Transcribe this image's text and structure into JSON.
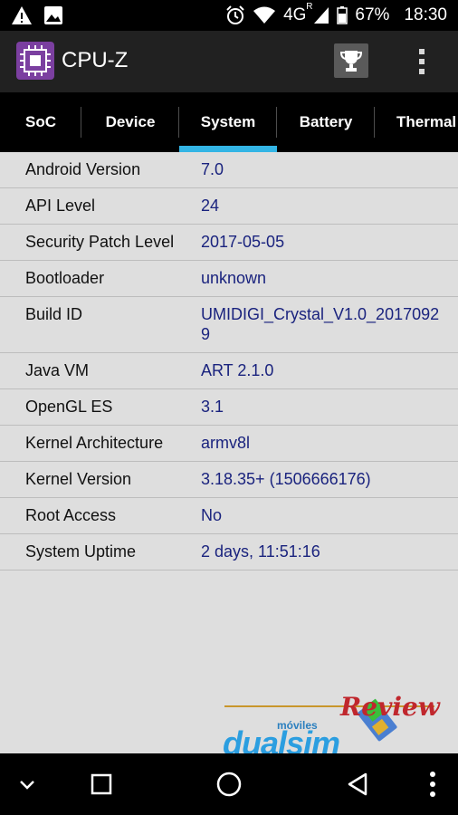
{
  "status_bar": {
    "left_icons": [
      "warning-icon",
      "image-icon"
    ],
    "right_icons": [
      "alarm-icon",
      "wifi-icon",
      "signal-icon"
    ],
    "network": "4G",
    "roaming": "R",
    "battery": "67%",
    "time": "18:30"
  },
  "app_bar": {
    "title": "CPU-Z",
    "logo_icon": "cpu-chip-icon",
    "trophy_icon": "trophy-icon",
    "menu_icon": "overflow-menu-icon"
  },
  "tabs": [
    {
      "label": "SoC",
      "active": false
    },
    {
      "label": "Device",
      "active": false
    },
    {
      "label": "System",
      "active": true
    },
    {
      "label": "Battery",
      "active": false
    },
    {
      "label": "Thermal",
      "active": false
    }
  ],
  "system_info": [
    {
      "key": "Android Version",
      "value": "7.0"
    },
    {
      "key": "API Level",
      "value": "24"
    },
    {
      "key": "Security Patch Level",
      "value": "2017-05-05"
    },
    {
      "key": "Bootloader",
      "value": "unknown"
    },
    {
      "key": "Build ID",
      "value": "UMIDIGI_Crystal_V1.0_2017092\n9"
    },
    {
      "key": "Java VM",
      "value": "ART 2.1.0"
    },
    {
      "key": "OpenGL ES",
      "value": "3.1"
    },
    {
      "key": "Kernel Architecture",
      "value": "armv8l"
    },
    {
      "key": "Kernel Version",
      "value": "3.18.35+ (1506666176)"
    },
    {
      "key": "Root Access",
      "value": "No"
    },
    {
      "key": "System Uptime",
      "value": "2 days, 11:51:16"
    }
  ],
  "watermark": {
    "small_text": "móviles",
    "brand": "dualsim",
    "script_text": "Review"
  },
  "nav_bar": {
    "icons": [
      "collapse-icon",
      "recents-icon",
      "home-icon",
      "back-icon",
      "more-icon"
    ]
  },
  "colors": {
    "accent": "#33b5e5",
    "value_text": "#1a237e",
    "content_bg": "#dedede",
    "appbar_bg": "#212121"
  }
}
